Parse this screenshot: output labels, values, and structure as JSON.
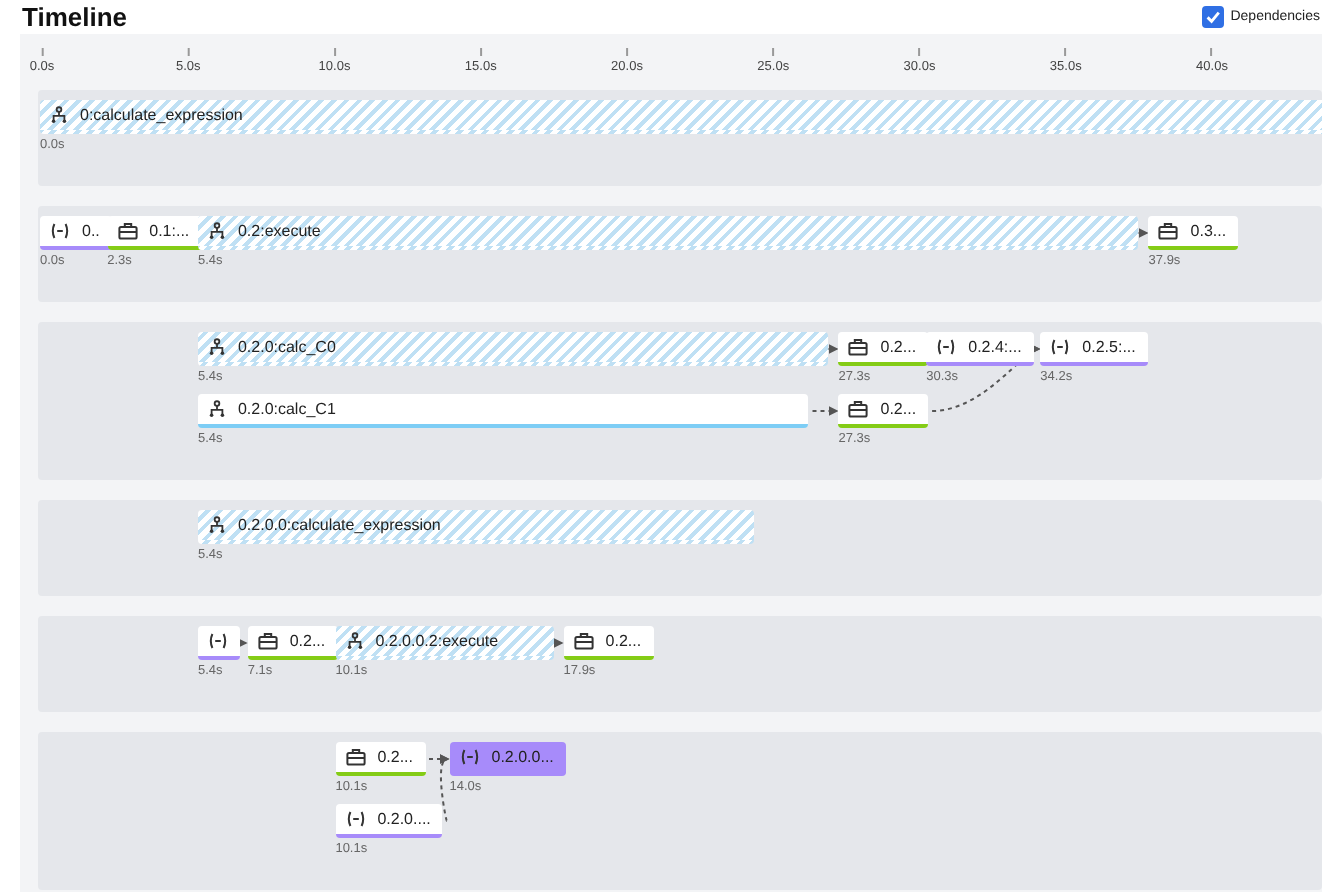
{
  "title": "Timeline",
  "dependencies": {
    "label": "Dependencies",
    "checked": true
  },
  "ticks": [
    "0.0s",
    "5.0s",
    "10.0s",
    "15.0s",
    "20.0s",
    "25.0s",
    "30.0s",
    "35.0s",
    "40.0s"
  ],
  "lanes": [
    {
      "rows": [
        [
          {
            "kind": "group_hatched",
            "label": "0:calculate_expression",
            "time": "0.0s",
            "selected": false
          }
        ]
      ]
    },
    {
      "rows": [
        [
          {
            "kind": "script",
            "label": "0..",
            "time": "0.0s",
            "selected": false
          },
          {
            "kind": "task",
            "label": "0.1:...",
            "time": "2.3s",
            "selected": false
          },
          {
            "kind": "group_hatched",
            "label": "0.2:execute",
            "time": "5.4s",
            "selected": false
          },
          {
            "kind": "task",
            "label": "0.3...",
            "time": "37.9s",
            "selected": false
          }
        ]
      ]
    },
    {
      "rows": [
        [
          {
            "kind": "group_hatched",
            "label": "0.2.0:calc_C0",
            "time": "5.4s",
            "selected": false
          },
          {
            "kind": "task",
            "label": "0.2...",
            "time": "27.3s",
            "selected": false
          },
          {
            "kind": "script",
            "label": "0.2.4:...",
            "time": "30.3s",
            "selected": false
          },
          {
            "kind": "script",
            "label": "0.2.5:...",
            "time": "34.2s",
            "selected": false
          }
        ],
        [
          {
            "kind": "group",
            "label": "0.2.0:calc_C1",
            "time": "5.4s",
            "selected": false
          },
          {
            "kind": "task",
            "label": "0.2...",
            "time": "27.3s",
            "selected": false
          }
        ]
      ]
    },
    {
      "rows": [
        [
          {
            "kind": "group_hatched",
            "label": "0.2.0.0:calculate_expression",
            "time": "5.4s",
            "selected": false
          }
        ]
      ]
    },
    {
      "rows": [
        [
          {
            "kind": "script",
            "time": "5.4s",
            "selected": false
          },
          {
            "kind": "task",
            "label": "0.2...",
            "time": "7.1s",
            "selected": false
          },
          {
            "kind": "group_hatched",
            "label": "0.2.0.0.2:execute",
            "time": "10.1s",
            "selected": false
          },
          {
            "kind": "task",
            "label": "0.2...",
            "time": "17.9s",
            "selected": false
          }
        ]
      ]
    },
    {
      "rows": [
        [
          {
            "kind": "task",
            "label": "0.2...",
            "time": "10.1s",
            "selected": false
          },
          {
            "kind": "script",
            "label": "0.2.0.0...",
            "time": "14.0s",
            "selected": true
          }
        ],
        [
          {
            "kind": "script",
            "label": "0.2.0....",
            "time": "10.1s",
            "selected": false
          }
        ]
      ]
    }
  ]
}
